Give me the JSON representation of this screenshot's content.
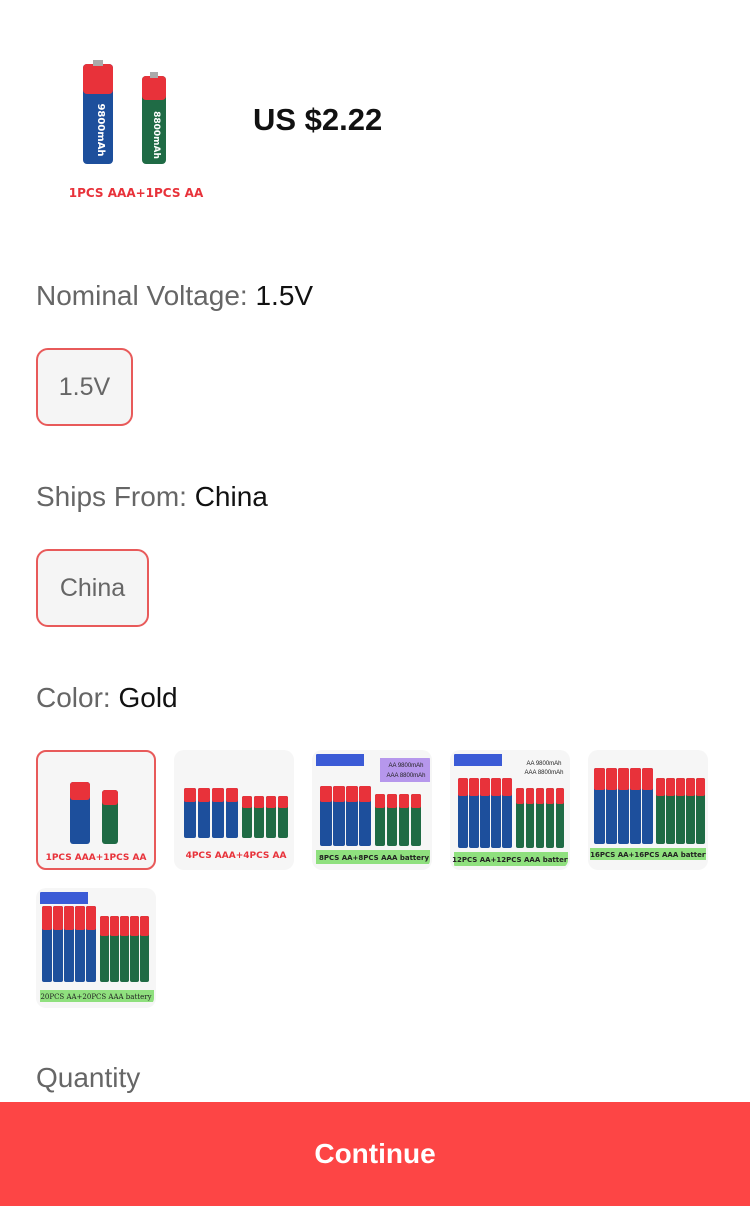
{
  "product": {
    "price": "US $2.22",
    "thumb_caption": "1PCS AAA+1PCS AA",
    "cell_labels": [
      "9800mAh",
      "8800mAh"
    ]
  },
  "attributes": {
    "voltage": {
      "label": "Nominal Voltage: ",
      "selected": "1.5V",
      "options": [
        "1.5V"
      ]
    },
    "ships_from": {
      "label": "Ships From: ",
      "selected": "China",
      "options": [
        "China"
      ]
    },
    "color": {
      "label": "Color: ",
      "selected": "Gold",
      "swatches": [
        {
          "caption": "1PCS AAA+1PCS AA"
        },
        {
          "caption": "4PCS AAA+4PCS AA"
        },
        {
          "caption": "8PCS AA+8PCS AAA battery",
          "note1": "AA 9800mAh",
          "note2": "AAA 8800mAh"
        },
        {
          "caption": "12PCS AA+12PCS AAA battery",
          "note1": "AA 9800mAh",
          "note2": "AAA 8800mAh"
        },
        {
          "caption": "16PCS AA+16PCS AAA battery"
        },
        {
          "caption": "20PCS AA+20PCS AAA battery"
        }
      ]
    }
  },
  "quantity": {
    "label": "Quantity"
  },
  "footer": {
    "continue_label": "Continue"
  },
  "colors": {
    "accent": "#fd4545",
    "selected_border": "#e85a5a",
    "battery_red": "#e8323a",
    "battery_blue": "#1d4f9c",
    "battery_green": "#1f6b45"
  }
}
